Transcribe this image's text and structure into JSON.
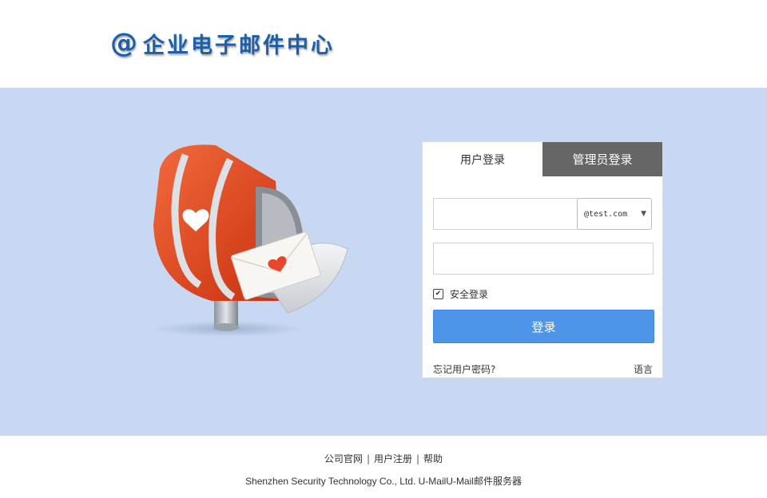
{
  "header": {
    "logo_symbol": "@",
    "logo_text": "企业电子邮件中心"
  },
  "login": {
    "tabs": [
      {
        "label": "用户登录",
        "active": true
      },
      {
        "label": "管理员登录",
        "active": false
      }
    ],
    "username": {
      "value": "",
      "placeholder": ""
    },
    "domain": {
      "selected": "@test.com"
    },
    "password": {
      "value": "",
      "placeholder": ""
    },
    "secure_login": {
      "label": "安全登录",
      "checked": true
    },
    "submit_label": "登录",
    "forgot_label": "忘记用户密码?",
    "language_label": "语言"
  },
  "footer": {
    "links": [
      "公司官网",
      "用户注册",
      "帮助"
    ],
    "separator": "|",
    "copyright": "Shenzhen Security Technology Co., Ltd. U-MailU-Mail邮件服务器"
  },
  "colors": {
    "band_background": "#c8d8f2",
    "logo_blue": "#1d5fa8",
    "login_button": "#4e94e8",
    "inactive_tab": "#666666",
    "mailbox_red": "#e0411f"
  }
}
